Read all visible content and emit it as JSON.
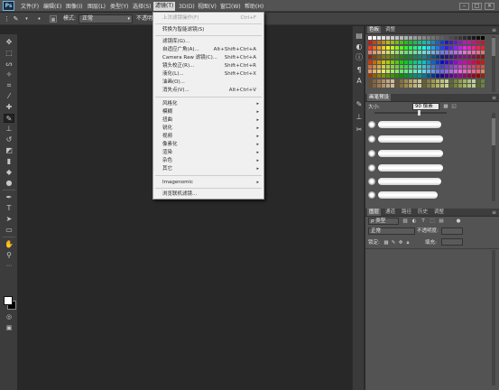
{
  "app": {
    "logo": "Ps"
  },
  "menubar": {
    "items": [
      "文件(F)",
      "编辑(E)",
      "图像(I)",
      "图层(L)",
      "类型(Y)",
      "选择(S)",
      "滤镜(T)",
      "3D(D)",
      "视图(V)",
      "窗口(W)",
      "帮助(H)"
    ],
    "active": "滤镜(T)"
  },
  "options": {
    "mode_label": "模式:",
    "mode_value": "正常",
    "opacity_label": "不透明"
  },
  "filter_menu": {
    "items": [
      {
        "label": "上次滤镜操作(F)",
        "shortcut": "Ctrl+F",
        "disabled": true
      },
      {
        "label": "转换为智能滤镜(S)",
        "shortcut": ""
      },
      {
        "label": "滤镜库(G)...",
        "shortcut": ""
      },
      {
        "label": "自适应广角(A)...",
        "shortcut": "Alt+Shift+Ctrl+A"
      },
      {
        "label": "Camera Raw 滤镜(C)...",
        "shortcut": "Shift+Ctrl+A"
      },
      {
        "label": "镜头校正(R)...",
        "shortcut": "Shift+Ctrl+R"
      },
      {
        "label": "液化(L)...",
        "shortcut": "Shift+Ctrl+X"
      },
      {
        "label": "油画(O)...",
        "shortcut": ""
      },
      {
        "label": "消失点(V)...",
        "shortcut": "Alt+Ctrl+V"
      },
      {
        "label": "风格化",
        "submenu": true
      },
      {
        "label": "模糊",
        "submenu": true
      },
      {
        "label": "扭曲",
        "submenu": true
      },
      {
        "label": "锐化",
        "submenu": true
      },
      {
        "label": "视频",
        "submenu": true
      },
      {
        "label": "像素化",
        "submenu": true
      },
      {
        "label": "渲染",
        "submenu": true
      },
      {
        "label": "杂色",
        "submenu": true
      },
      {
        "label": "其它",
        "submenu": true
      },
      {
        "label": "Imagenomic",
        "submenu": true
      },
      {
        "label": "浏览联机滤镜...",
        "shortcut": ""
      }
    ]
  },
  "swatches_panel": {
    "tabs": [
      "色板",
      "调整"
    ]
  },
  "brush_panel": {
    "tabs": [
      "画笔预设"
    ],
    "size_label": "大小:",
    "size_value": "90 像素"
  },
  "layers_panel": {
    "tabs": [
      "图层",
      "通道",
      "路径",
      "历史",
      "调整"
    ],
    "kind_label": "ρ 类型",
    "blend_mode": "正常",
    "opacity_label": "不透明度:",
    "lock_label": "锁定:",
    "fill_label": "填充:"
  },
  "colors": {
    "accent": "#6fb7e6",
    "menu_bg": "#f0f0f0",
    "ui_bg": "#535353",
    "canvas_bg": "#282828"
  }
}
